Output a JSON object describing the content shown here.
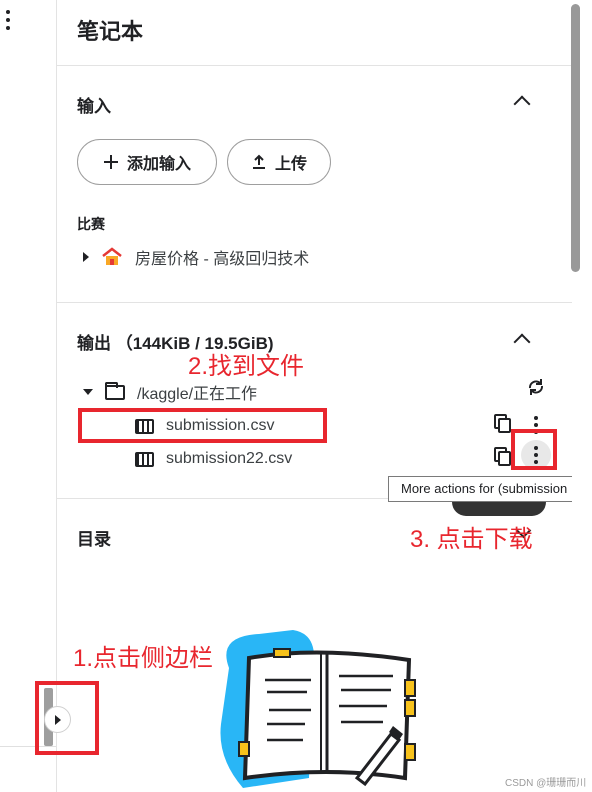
{
  "panel": {
    "title": "笔记本"
  },
  "input_section": {
    "title": "输入",
    "add_input_label": "添加输入",
    "upload_label": "上传",
    "competition_label": "比赛",
    "competition_item": "房屋价格 - 高级回归技术"
  },
  "output_section": {
    "title": "输出 （144KiB / 19.5GiB)",
    "folder": "/kaggle/正在工作",
    "files": [
      "submission.csv",
      "submission22.csv"
    ]
  },
  "tooltip": {
    "text": "More actions for (submission"
  },
  "toc_section": {
    "title": "目录"
  },
  "annotations": {
    "step1": "1.点击侧边栏",
    "step2": "2.找到文件",
    "step3": "3. 点击下载"
  },
  "watermark": "CSDN @珊珊而川",
  "icons": [
    "more-vertical-icon",
    "chevron-up-icon",
    "chevron-down-icon",
    "plus-icon",
    "upload-icon",
    "house-icon",
    "folder-icon",
    "table-icon",
    "refresh-icon",
    "copy-icon",
    "caret-right-icon",
    "caret-down-icon",
    "notebook-illustration"
  ],
  "colors": {
    "annotation_red": "#e8262e",
    "illustration_blue": "#29b6f6",
    "illustration_yellow": "#f7c21b"
  }
}
